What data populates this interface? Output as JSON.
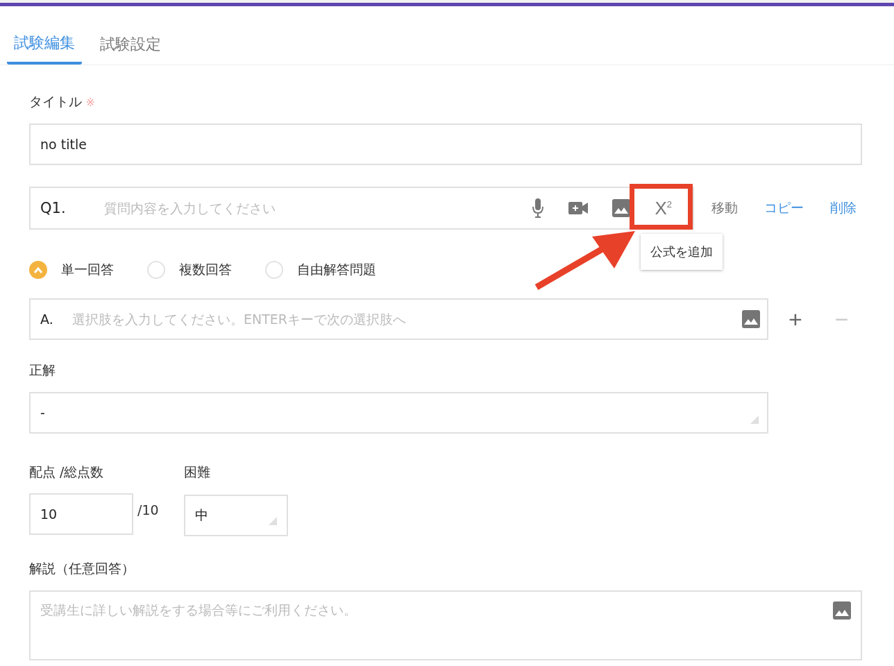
{
  "tabs": [
    {
      "label": "試験編集",
      "selected": true
    },
    {
      "label": "試験設定",
      "selected": false
    }
  ],
  "title_field": {
    "label": "タイトル",
    "required_mark": "※",
    "value": "no title"
  },
  "question": {
    "number": "Q1.",
    "placeholder": "質問内容を入力してください",
    "formula_button": "X$^{2}$",
    "tooltip": "公式を追加",
    "highlighted": true,
    "pointer_arrow": true,
    "actions": [
      {
        "label": "移動",
        "kind": "plain"
      },
      {
        "label": "コピー",
        "kind": "link"
      },
      {
        "label": "削除",
        "kind": "link"
      }
    ]
  },
  "answer_types": [
    {
      "label": "単一回答",
      "selected": true
    },
    {
      "label": "複数回答",
      "selected": false
    },
    {
      "label": "自由解答問題",
      "selected": false
    }
  ],
  "choice": {
    "letter": "A.",
    "placeholder": "選択肢を入力してください。ENTERキーで次の選択肢へ",
    "can_remove": false,
    "add_button": "+",
    "remove_button": "−"
  },
  "correct_answer": {
    "label": "正解",
    "value": "-"
  },
  "score": {
    "label": "配点 /総点数",
    "value": "10",
    "total": "/10"
  },
  "difficulty": {
    "label": "困難",
    "value": "中"
  },
  "explanation": {
    "label": "解説（任意回答）",
    "placeholder": "受講生に詳しい解説をする場合等にご利用ください。"
  }
}
